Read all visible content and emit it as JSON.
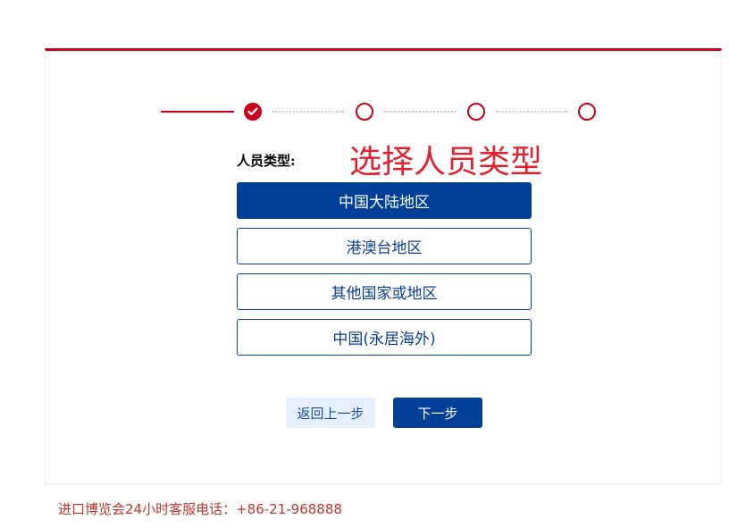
{
  "stepper": {
    "current_step": 1,
    "total_steps": 4
  },
  "form": {
    "type_label": "人员类型:",
    "annotation": "选择人员类型",
    "options": [
      {
        "label": "中国大陆地区",
        "selected": true
      },
      {
        "label": "港澳台地区",
        "selected": false
      },
      {
        "label": "其他国家或地区",
        "selected": false
      },
      {
        "label": "中国(永居海外)",
        "selected": false
      }
    ]
  },
  "actions": {
    "back_label": "返回上一步",
    "next_label": "下一步"
  },
  "footer": {
    "hotline_label": "进口博览会24小时客服电话：",
    "hotline_number": "+86-21-968888"
  },
  "colors": {
    "accent_red": "#c8001a",
    "primary_blue": "#003f98",
    "annotation_red": "#e3202e"
  }
}
